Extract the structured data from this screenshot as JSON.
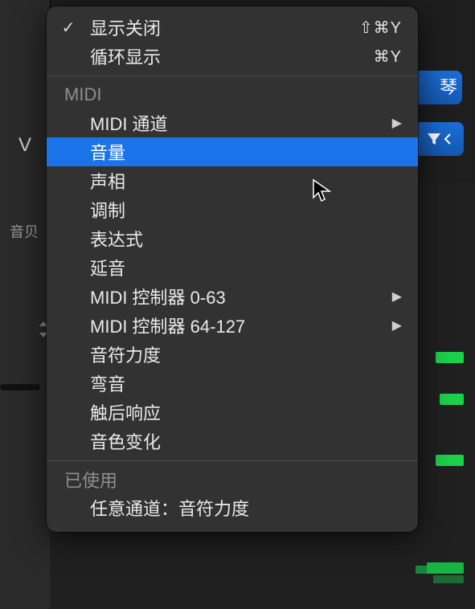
{
  "background": {
    "left_label": "V",
    "truncated_text": "音贝",
    "pill_label": "琴"
  },
  "menu": {
    "topItems": [
      {
        "checked": true,
        "label": "显示关闭",
        "shortcut": "⇧⌘Y"
      },
      {
        "checked": false,
        "label": "循环显示",
        "shortcut": "⌘Y"
      }
    ],
    "section_midi": "MIDI",
    "midiItems": [
      {
        "label": "MIDI 通道",
        "submenu": true,
        "highlight": false
      },
      {
        "label": "音量",
        "submenu": false,
        "highlight": true
      },
      {
        "label": "声相",
        "submenu": false,
        "highlight": false
      },
      {
        "label": "调制",
        "submenu": false,
        "highlight": false
      },
      {
        "label": "表达式",
        "submenu": false,
        "highlight": false
      },
      {
        "label": "延音",
        "submenu": false,
        "highlight": false
      },
      {
        "label": "MIDI 控制器 0-63",
        "submenu": true,
        "highlight": false
      },
      {
        "label": "MIDI 控制器 64-127",
        "submenu": true,
        "highlight": false
      },
      {
        "label": "音符力度",
        "submenu": false,
        "highlight": false
      },
      {
        "label": "弯音",
        "submenu": false,
        "highlight": false
      },
      {
        "label": "触后响应",
        "submenu": false,
        "highlight": false
      },
      {
        "label": "音色变化",
        "submenu": false,
        "highlight": false
      }
    ],
    "section_used": "已使用",
    "usedItems": [
      {
        "label": "任意通道：音符力度"
      }
    ]
  }
}
